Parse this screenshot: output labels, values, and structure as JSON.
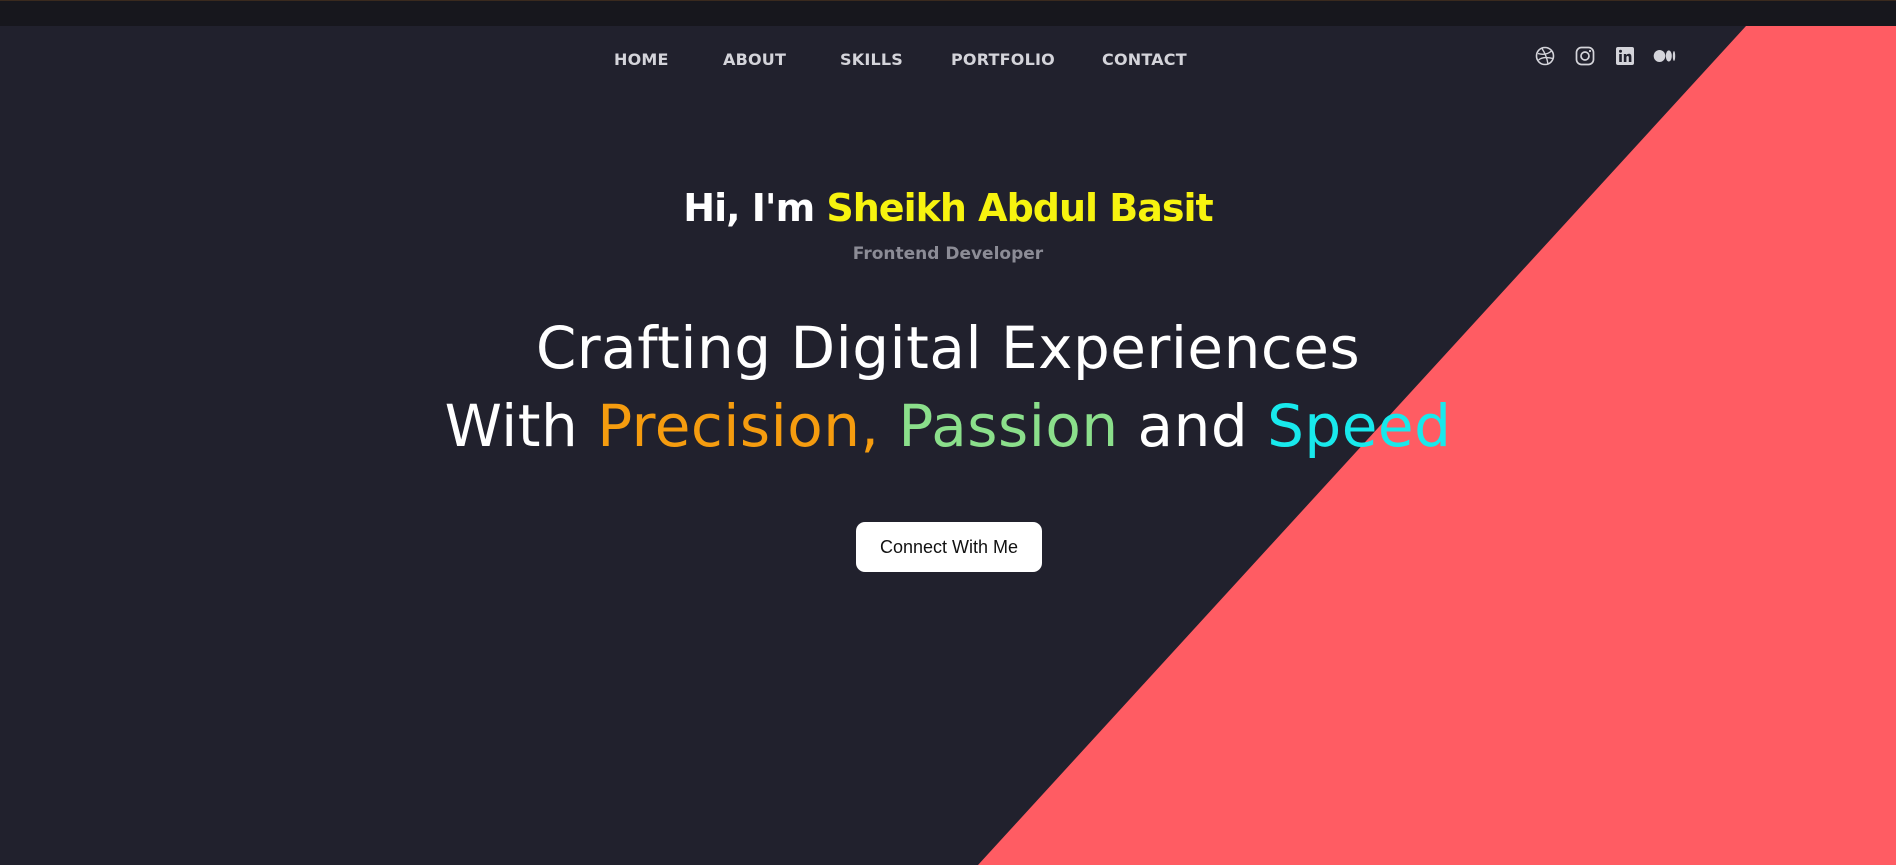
{
  "nav": {
    "items": [
      {
        "label": "HOME"
      },
      {
        "label": "ABOUT"
      },
      {
        "label": "SKILLS"
      },
      {
        "label": "PORTFOLIO"
      },
      {
        "label": "CONTACT"
      }
    ]
  },
  "social": {
    "icons": [
      "dribbble-icon",
      "instagram-icon",
      "linkedin-icon",
      "medium-icon"
    ]
  },
  "hero": {
    "greeting_prefix": "Hi, I'm ",
    "greeting_name": "Sheikh Abdul Basit",
    "role": "Frontend Developer",
    "headline_line1": "Crafting Digital Experiences",
    "headline_with": "With ",
    "headline_precision": "Precision,",
    "headline_passion": "Passion",
    "headline_and": " and ",
    "headline_speed": "Speed",
    "cta_label": "Connect With Me"
  },
  "colors": {
    "background": "#21212d",
    "accent_shape": "#ff5c63",
    "name": "#f7f30f",
    "precision": "#f59c0f",
    "passion": "#8bdf8b",
    "speed": "#18e9ec"
  }
}
